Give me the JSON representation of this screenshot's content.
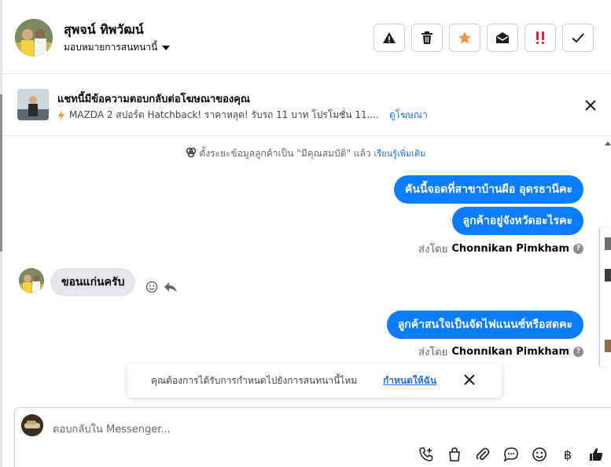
{
  "header": {
    "contact_name": "สุพจน์ ทิพวัฒน์",
    "assign_label": "มอบหมายการสนทนานี้",
    "actions": [
      "warning-icon",
      "trash-icon",
      "star-icon",
      "mark-unread-icon",
      "priority-icon",
      "check-icon"
    ],
    "star_color": "#f7923b",
    "priority_color": "#e41e3f"
  },
  "ad": {
    "title": "แชทนี้มีข้อความตอบกลับต่อโฆษณาของคุณ",
    "subtitle": "MAZDA 2 สปอร์ต Hatchback! ราคาหลุด! รับรถ 11 บาท โปรโมชั่น 11....",
    "link": "ดูโฆษณา"
  },
  "conversation": {
    "system_note": "ตั้งระยะข้อมูลลูกค้าเป็น \"มีคุณสมบัติ\" แล้ว",
    "learn_more": "เรียนรู้เพิ่มเติม",
    "messages": [
      {
        "text": "คันนี้จอดที่สาขาบ้านผือ อุดรธานีคะ"
      },
      {
        "text": "ลูกค้าอยู่จังหวัดอะไรคะ"
      },
      {
        "text": "ขอนแก่นครับ"
      },
      {
        "text": "ลูกค้าสนใจเป็นจัดไฟแนนซ์หรือสดคะ"
      }
    ],
    "sent_by_prefix": "ส่งโดย",
    "sent_by_name": "Chonnikan Pimkham"
  },
  "reminder": {
    "text": "คุณต้องการได้รับการกำหนดไปยังการสนทนานี้ไหม",
    "link": "กำหนดให้ฉัน"
  },
  "composer": {
    "placeholder": "ตอบกลับใน Messenger...",
    "tools": [
      "call-add-icon",
      "shopping-bag-icon",
      "attachment-icon",
      "chat-bubble-icon",
      "emoji-icon",
      "baht-icon",
      "thumbs-up-icon"
    ],
    "baht_symbol": "฿"
  },
  "accent_color": "#0a7cff"
}
